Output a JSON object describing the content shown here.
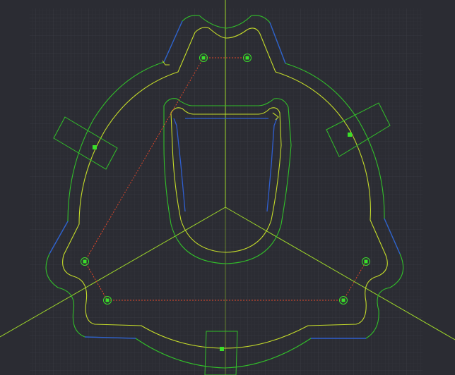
{
  "app": {
    "view": "sketch"
  },
  "colors": {
    "background": "#2b2c33",
    "grid_minor": "#33343c",
    "grid_major": "#3a3b44",
    "axis": "#9ed62a",
    "outline_inner": "#c5dc2a",
    "outline_outer": "#32c02a",
    "tangent_edge": "#2f5fd0",
    "construction": "#e0472a",
    "point": "#3adf2a",
    "box": "#32c02a"
  },
  "sketch": {
    "constraint_points": [
      {
        "name": "constraint-point-1"
      },
      {
        "name": "constraint-point-2"
      },
      {
        "name": "constraint-point-3"
      },
      {
        "name": "constraint-point-4"
      },
      {
        "name": "constraint-point-5"
      },
      {
        "name": "constraint-point-6"
      }
    ],
    "spokes": 3,
    "boxes": 3,
    "slot": "cam-slot"
  }
}
